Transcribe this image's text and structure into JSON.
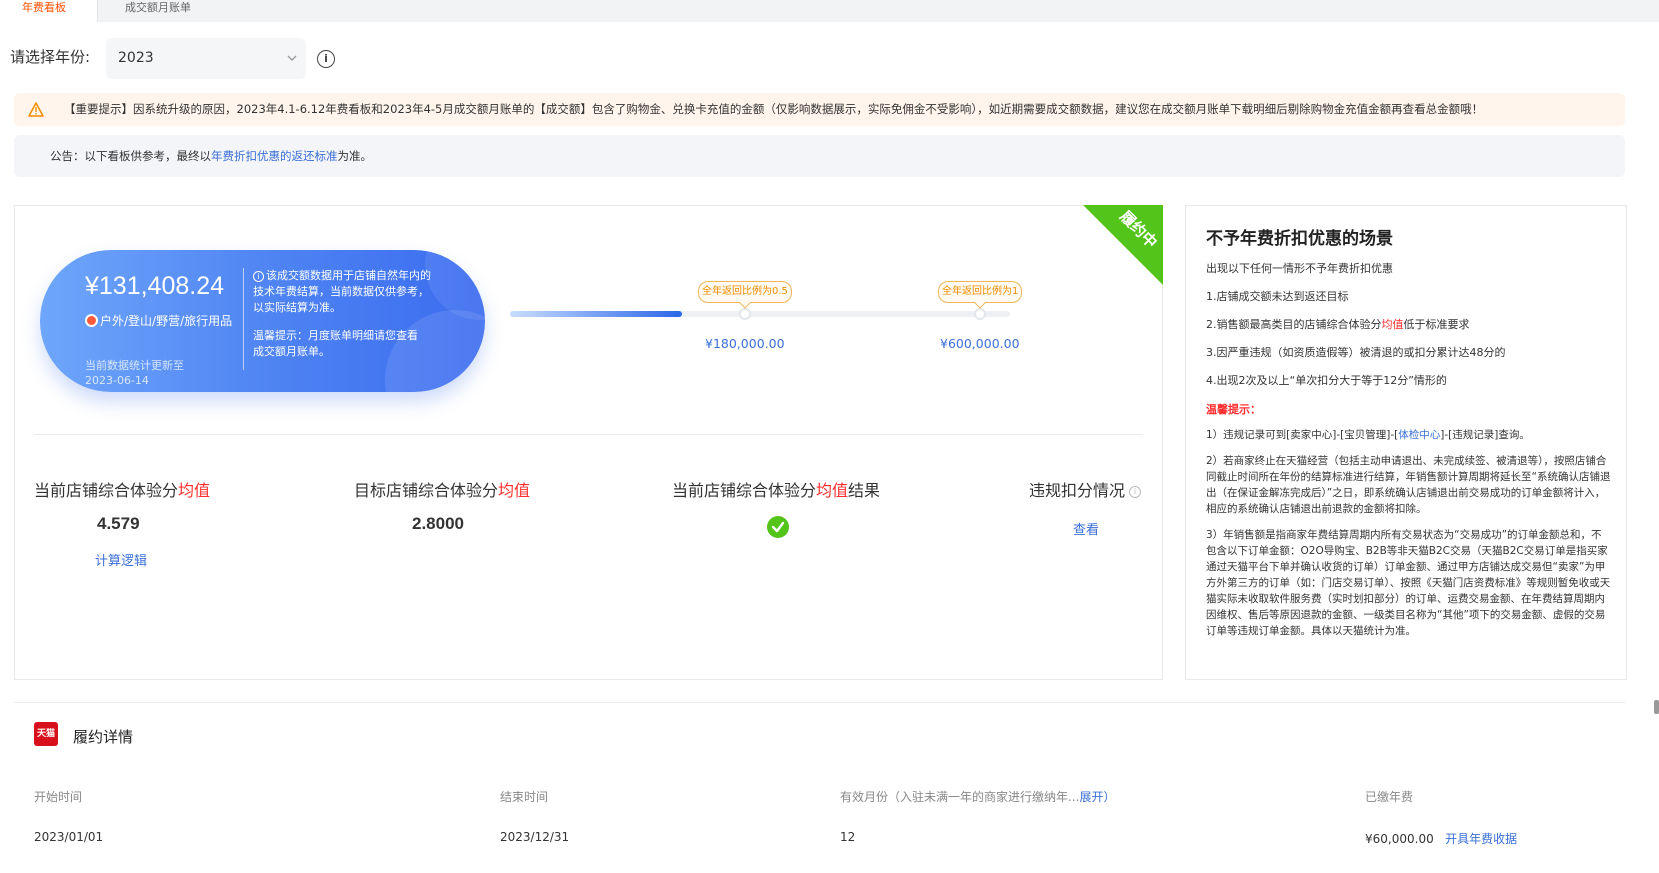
{
  "tabs": [
    {
      "label": "年费看板",
      "active": true
    },
    {
      "label": "成交额月账单",
      "active": false
    }
  ],
  "year_filter": {
    "label": "请选择年份:",
    "value": "2023"
  },
  "warning": {
    "text": "【重要提示】因系统升级的原因，2023年4.1-6.12年费看板和2023年4-5月成交额月账单的【成交额】包含了购物金、兑换卡充值的金额（仅影响数据展示，实际免佣金不受影响），如近期需要成交额数据，建议您在成交额月账单下载明细后剔除购物金充值金额再查看总金额哦！",
    "color": "#fff5ec"
  },
  "announcement": {
    "prefix": "公告：以下看板供参考，最终以",
    "link": "年费折扣优惠的返还标准",
    "suffix": "为准。"
  },
  "status_ribbon": "履约中",
  "summary": {
    "amount": "¥131,408.24",
    "category": "户外/登山/野营/旅行用品",
    "update_note": "当前数据统计更新至2023-06-14",
    "note1": "该成交额数据用于店铺自然年内的技术年费结算，当前数据仅供参考，以实际结算为准。",
    "note2": "温馨提示：月度账单明细请您查看成交额月账单。"
  },
  "progress": {
    "current": 131408.24,
    "max": 600000,
    "milestones": [
      {
        "tag": "全年返回比例为0.5",
        "value_label": "¥180,000.00",
        "value": 180000
      },
      {
        "tag": "全年返回比例为1",
        "value_label": "¥600,000.00",
        "value": 600000
      }
    ]
  },
  "metrics": {
    "current_score": {
      "title": "当前店铺综合体验分",
      "highlight": "均值",
      "value": "4.579",
      "link": "计算逻辑"
    },
    "target_score": {
      "title": "目标店铺综合体验分",
      "highlight": "均值",
      "value": "2.8000"
    },
    "score_result": {
      "title": "当前店铺综合体验分",
      "highlight": "均值",
      "suffix": "结果",
      "status": "passed"
    },
    "violation": {
      "title": "违规扣分情况",
      "link": "查看"
    }
  },
  "side_panel": {
    "title": "不予年费折扣优惠的场景",
    "intro": "出现以下任何一情形不予年费折扣优惠",
    "item1": "1.店铺成交额未达到返还目标",
    "item2_prefix": "2.销售额最高类目的店铺综合体验分",
    "item2_highlight": "均值",
    "item2_suffix": "低于标准要求",
    "item3": "3.因严重违规（如资质造假等）被清退的或扣分累计达48分的",
    "item4": "4.出现2次及以上“单次扣分大于等于12分”情形的",
    "tip_title": "温馨提示：",
    "tip1_prefix": "1）违规记录可到[卖家中心]-[宝贝管理]-[",
    "tip1_link": "体检中心",
    "tip1_suffix": "]-[违规记录]查询。",
    "tip2": "2）若商家终止在天猫经营（包括主动申请退出、未完成续签、被清退等），按照店铺合同截止时间所在年份的结算标准进行结算，年销售额计算周期将延长至“系统确认店铺退出（在保证金解冻完成后）”之日，即系统确认店铺退出前交易成功的订单金额将计入，相应的系统确认店铺退出前退款的金额将扣除。",
    "tip3": "3）年销售额是指商家年费结算周期内所有交易状态为“交易成功”的订单金额总和，不包含以下订单金额：O2O导购宝、B2B等非天猫B2C交易（天猫B2C交易订单是指买家通过天猫平台下单并确认收货的订单）订单金额、通过甲方店铺达成交易但“卖家”为甲方外第三方的订单（如：门店交易订单）、按照《天猫门店资费标准》等规则暂免收或天猫实际未收取软件服务费（实时划扣部分）的订单、运费交易金额、在年费结算周期内因维权、售后等原因退款的金额、一级类目名称为“其他”项下的交易金额、虚假的交易订单等违规订单金额。具体以天猫统计为准。"
  },
  "detail": {
    "logo_text": "天猫",
    "title": "履约详情",
    "columns": [
      {
        "label": "开始时间",
        "value": "2023/01/01"
      },
      {
        "label": "结束时间",
        "value": "2023/12/31"
      },
      {
        "label": "有效月份（入驻未满一年的商家进行缴纳年...",
        "label_link": "展开）",
        "value": "12"
      },
      {
        "label": "已缴年费",
        "value": "¥60,000.00",
        "value_link": "开具年费收据"
      }
    ]
  }
}
